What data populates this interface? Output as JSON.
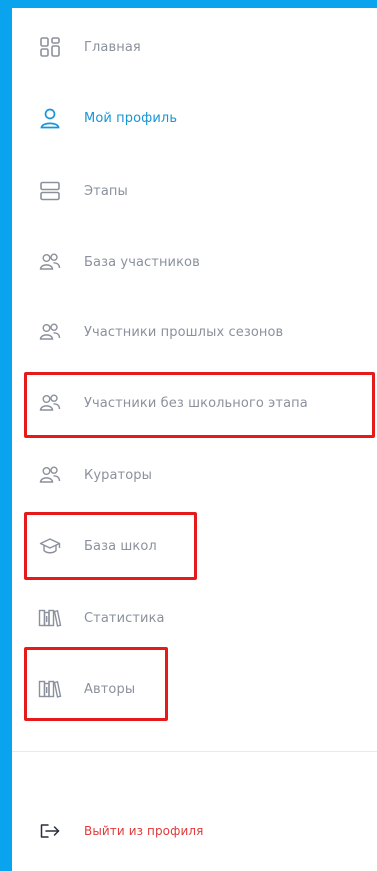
{
  "nav": {
    "items": [
      {
        "label": "Главная",
        "icon": "grid-icon"
      },
      {
        "label": "Мой профиль",
        "icon": "user-icon"
      },
      {
        "label": "Этапы",
        "icon": "stages-icon"
      },
      {
        "label": "База участников",
        "icon": "users-icon"
      },
      {
        "label": "Участники прошлых сезонов",
        "icon": "users-icon"
      },
      {
        "label": "Участники без школьного этапа",
        "icon": "users-icon"
      },
      {
        "label": "Кураторы",
        "icon": "users-icon"
      },
      {
        "label": "База школ",
        "icon": "graduation-cap-icon"
      },
      {
        "label": "Статистика",
        "icon": "books-icon"
      },
      {
        "label": "Авторы",
        "icon": "books-icon"
      }
    ],
    "logout_label": "Выйти из профиля"
  },
  "colors": {
    "frame": "#0aa4ee",
    "active": "#1795d6",
    "inactive": "#8b919c",
    "logout": "#e33939",
    "highlight": "#e51a1a"
  }
}
